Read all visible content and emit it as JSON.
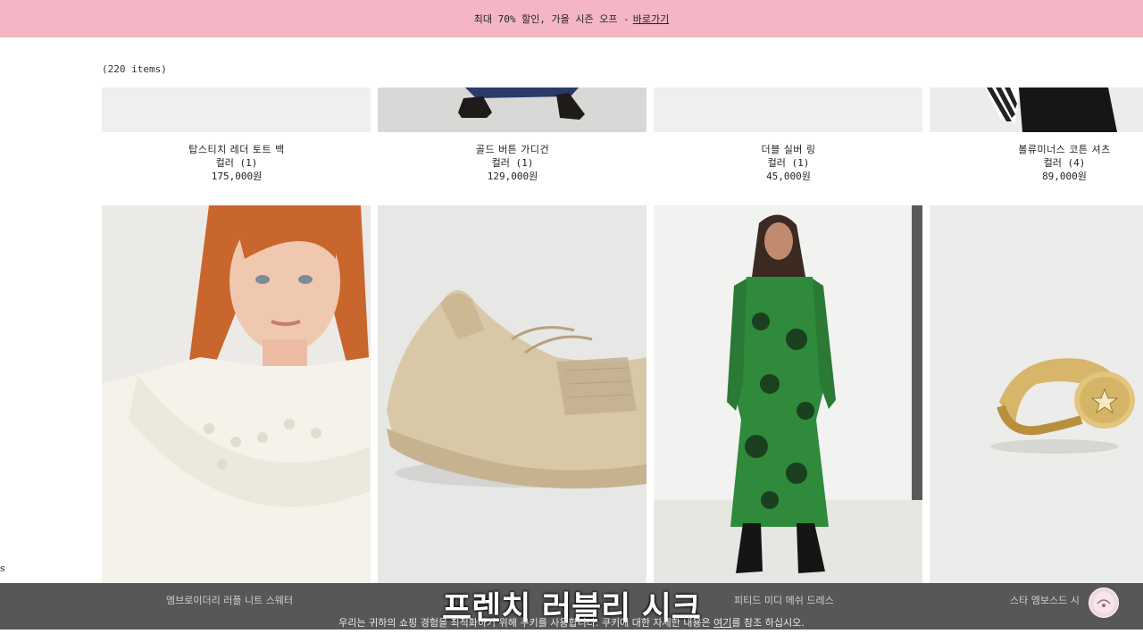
{
  "promo": {
    "text": "최대 70% 할인, 가을 시즌 오프 -",
    "link": " 바로가기"
  },
  "items_count": "(220 items)",
  "left_edge_text": "s",
  "top_row": [
    {
      "name": "탑스티치 레더 토트 백",
      "color": "컬러 (1)",
      "price": "175,000원"
    },
    {
      "name": "골드 버튼 가디건",
      "color": "컬러 (1)",
      "price": "129,000원"
    },
    {
      "name": "더블 실버 링",
      "color": "컬러 (1)",
      "price": "45,000원"
    },
    {
      "name": "볼류미너스 코튼 셔츠",
      "color": "컬러 (4)",
      "price": "89,000원"
    }
  ],
  "bottom_row": [
    {
      "name": "엠브로이더리 러플 니트 스웨터",
      "image": "ruffle-sweater-photo"
    },
    {
      "name": "",
      "image": "beige-sneaker-photo"
    },
    {
      "name": "피티드 미디 메쉬 드레스",
      "image": "green-mesh-dress-photo"
    },
    {
      "name": "스타 엠보스드 시",
      "image": "gold-signet-ring-photo"
    }
  ],
  "subtitle": "프렌치 러블리 시크",
  "cookie": {
    "before": "우리는 귀하의 쇼핑 경험을 최적화하기 위해 쿠키를 사용합니다. 쿠키에 대한 자세한 내용은 ",
    "link": "여기",
    "after": "를 참조 하십시오."
  },
  "colors": {
    "promo_bg": "#f4b6c4",
    "page_bg": "#ffffff"
  }
}
